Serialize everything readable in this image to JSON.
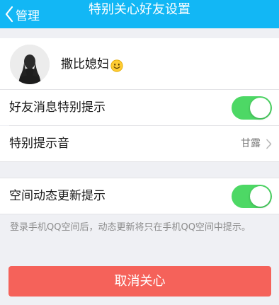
{
  "header": {
    "back_label": "管理",
    "title": "特别关心好友设置"
  },
  "profile": {
    "name": "撒比媳妇",
    "emoji": "smiling-face-emoji"
  },
  "settings": {
    "friend_message_alert": {
      "label": "好友消息特别提示",
      "enabled": true
    },
    "special_tone": {
      "label": "特别提示音",
      "value": "甘露"
    },
    "zone_update_alert": {
      "label": "空间动态更新提示",
      "enabled": true
    }
  },
  "hint": "登录手机QQ空间后，动态更新将只在手机QQ空间中提示。",
  "cancel_button": "取消关心",
  "colors": {
    "nav_bar": "#12b7f5",
    "toggle_on": "#4dd865",
    "cancel_button": "#f5625a",
    "page_background": "#eff0f4"
  }
}
